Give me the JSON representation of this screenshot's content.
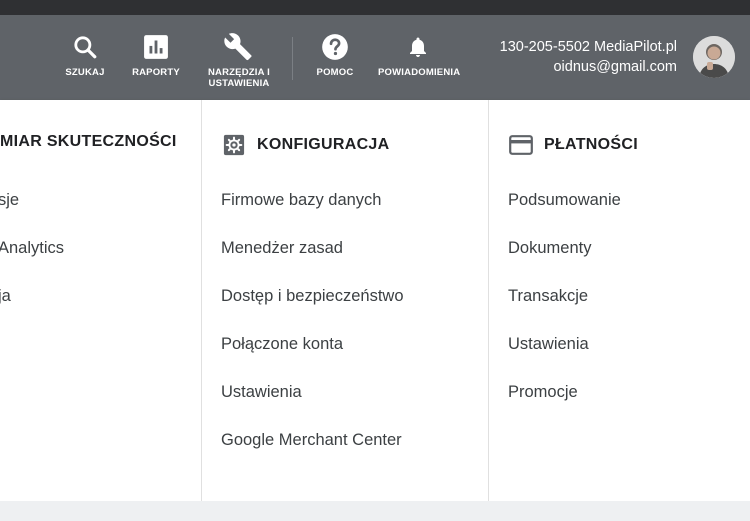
{
  "toolbar": {
    "tools": [
      {
        "label": "SZUKAJ",
        "icon": "search-icon"
      },
      {
        "label": "RAPORTY",
        "icon": "reports-icon"
      },
      {
        "label": "NARZĘDZIA I USTAWIENIA",
        "icon": "wrench-icon"
      },
      {
        "label": "POMOC",
        "icon": "help-icon"
      },
      {
        "label": "POWIADOMIENIA",
        "icon": "bell-icon"
      }
    ],
    "account": {
      "line1": "130-205-5502 MediaPilot.pl",
      "line2": "oidnus@gmail.com"
    }
  },
  "menu": {
    "columns": [
      {
        "title": "MIAR SKUTECZNOŚCI",
        "items": [
          "sje",
          "Analytics",
          "ja"
        ]
      },
      {
        "title": "KONFIGURACJA",
        "icon": "gear-icon",
        "items": [
          "Firmowe bazy danych",
          "Menedżer zasad",
          "Dostęp i bezpieczeństwo",
          "Połączone konta",
          "Ustawienia",
          "Google Merchant Center"
        ]
      },
      {
        "title": "PŁATNOŚCI",
        "icon": "credit-card-icon",
        "items": [
          "Podsumowanie",
          "Dokumenty",
          "Transakcje",
          "Ustawienia",
          "Promocje"
        ]
      }
    ]
  },
  "colors": {
    "toolbar_bg": "#5f6368",
    "top_strip": "#2f3033",
    "panel_bg": "#ffffff",
    "text_primary": "#202124",
    "text_item": "#3c4043"
  }
}
